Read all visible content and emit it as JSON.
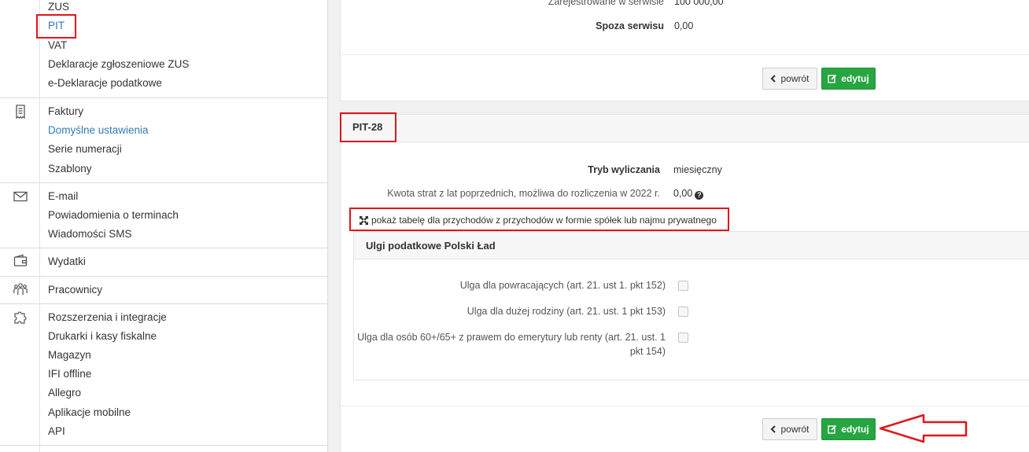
{
  "sidebar": {
    "group_top": {
      "items": [
        "ZUS",
        "PIT",
        "VAT",
        "Deklaracje zgłoszeniowe ZUS",
        "e-Deklaracje podatkowe"
      ],
      "active": "PIT"
    },
    "group_invoices": {
      "icon": "invoice-icon",
      "items": [
        "Faktury",
        "Domyślne ustawienia",
        "Serie numeracji",
        "Szablony"
      ],
      "active": "Domyślne ustawienia"
    },
    "group_email": {
      "icon": "envelope-icon",
      "items": [
        "E-mail",
        "Powiadomienia o terminach",
        "Wiadomości SMS"
      ]
    },
    "group_expenses": {
      "icon": "wallet-icon",
      "items": [
        "Wydatki"
      ]
    },
    "group_employees": {
      "icon": "people-icon",
      "items": [
        "Pracownicy"
      ]
    },
    "group_extensions": {
      "icon": "puzzle-icon",
      "items": [
        "Rozszerzenia i integracje",
        "Drukarki i kasy fiskalne",
        "Magazyn",
        "IFI offline",
        "Allegro",
        "Aplikacje mobilne",
        "API"
      ]
    }
  },
  "top_section": {
    "row1": {
      "label": "Zarejestrowane w serwisie",
      "value": "100 000,00"
    },
    "row2": {
      "label": "Spoza serwisu",
      "value": "0,00"
    },
    "back_label": "powrót",
    "edit_label": "edytuj"
  },
  "pit28": {
    "title": "PIT-28",
    "mode_label": "Tryb wyliczania",
    "mode_value": "miesięczny",
    "losses_label": "Kwota strat z lat poprzednich, możliwa do rozliczenia w 2022 r.",
    "losses_value": "0,00",
    "show_table_link": "pokaż tabelę dla przychodów z przychodów w formie spółek lub najmu prywatnego",
    "relief_panel": {
      "title": "Ulgi podatkowe Polski Ład",
      "items": [
        {
          "label": "Ulga dla powracających (art. 21. ust 1. pkt 152)",
          "checked": false
        },
        {
          "label": "Ulga dla dużej rodziny (art. 21. ust. 1 pkt 153)",
          "checked": false
        },
        {
          "label_line1": "Ulga dla osób 60+/65+ z prawem do emerytury lub renty (art. 21. ust. 1",
          "label_line2": "pkt 154)",
          "checked": false
        }
      ]
    },
    "back_label": "powrót",
    "edit_label": "edytuj"
  },
  "colors": {
    "accent_link": "#337ab7",
    "success": "#26a541",
    "annotation_red": "#e0151b"
  }
}
